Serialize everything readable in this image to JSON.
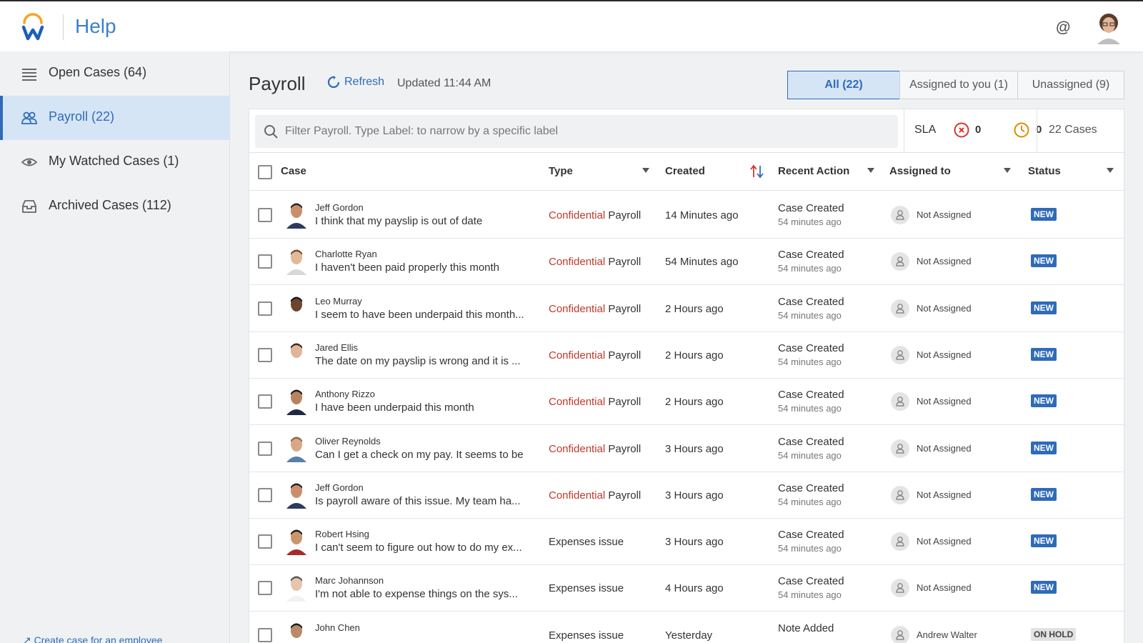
{
  "header": {
    "title": "Help"
  },
  "sidebar": {
    "items": [
      {
        "label": "Open Cases (64)",
        "icon": "list-icon"
      },
      {
        "label": "Payroll (22)",
        "icon": "group-icon"
      },
      {
        "label": "My Watched Cases (1)",
        "icon": "eye-icon"
      },
      {
        "label": "Archived Cases (112)",
        "icon": "archive-icon"
      }
    ],
    "active_index": 1,
    "create_link": "Create case for an employee"
  },
  "main": {
    "title": "Payroll",
    "refresh_label": "Refresh",
    "updated": "Updated 11:44 AM",
    "tabs": [
      {
        "label": "All (22)"
      },
      {
        "label": "Assigned to you (1)"
      },
      {
        "label": "Unassigned (9)"
      }
    ],
    "filter_placeholder": "Filter Payroll. Type Label: to narrow by a specific label",
    "sla": {
      "label": "SLA",
      "overdue": "0",
      "warning": "0"
    },
    "case_count": "22 Cases",
    "columns": {
      "case": "Case",
      "type": "Type",
      "created": "Created",
      "recent_action": "Recent Action",
      "assigned_to": "Assigned to",
      "status": "Status"
    },
    "rows": [
      {
        "name": "Jeff Gordon",
        "subject": "I think that my payslip is out of date",
        "type_prefix": "Confidential",
        "type": "Payroll",
        "created": "14 Minutes ago",
        "action": "Case Created",
        "action_time": "54 minutes ago",
        "assigned": "Not Assigned",
        "status": "NEW"
      },
      {
        "name": "Charlotte Ryan",
        "subject": "I haven't been paid properly this month",
        "type_prefix": "Confidential",
        "type": "Payroll",
        "created": "54 Minutes ago",
        "action": "Case Created",
        "action_time": "54 minutes ago",
        "assigned": "Not Assigned",
        "status": "NEW"
      },
      {
        "name": "Leo Murray",
        "subject": "I seem to have been underpaid this month...",
        "type_prefix": "Confidential",
        "type": "Payroll",
        "created": "2 Hours ago",
        "action": "Case Created",
        "action_time": "54 minutes ago",
        "assigned": "Not Assigned",
        "status": "NEW"
      },
      {
        "name": "Jared Ellis",
        "subject": "The date on my payslip is wrong and it is ...",
        "type_prefix": "Confidential",
        "type": "Payroll",
        "created": "2 Hours ago",
        "action": "Case Created",
        "action_time": "54 minutes ago",
        "assigned": "Not Assigned",
        "status": "NEW"
      },
      {
        "name": "Anthony Rizzo",
        "subject": "I have been underpaid this month",
        "type_prefix": "Confidential",
        "type": "Payroll",
        "created": "2 Hours ago",
        "action": "Case Created",
        "action_time": "54 minutes ago",
        "assigned": "Not Assigned",
        "status": "NEW"
      },
      {
        "name": "Oliver Reynolds",
        "subject": "Can I get a check on my pay. It seems to be",
        "type_prefix": "Confidential",
        "type": "Payroll",
        "created": "3 Hours ago",
        "action": "Case Created",
        "action_time": "54 minutes ago",
        "assigned": "Not Assigned",
        "status": "NEW"
      },
      {
        "name": "Jeff Gordon",
        "subject": "Is payroll aware of this issue. My team ha...",
        "type_prefix": "Confidential",
        "type": "Payroll",
        "created": "3 Hours ago",
        "action": "Case Created",
        "action_time": "54 minutes ago",
        "assigned": "Not Assigned",
        "status": "NEW"
      },
      {
        "name": "Robert Hsing",
        "subject": "I can't seem to figure out how to do my ex...",
        "type_prefix": "",
        "type": "Expenses issue",
        "created": "3 Hours ago",
        "action": "Case Created",
        "action_time": "54 minutes ago",
        "assigned": "Not Assigned",
        "status": "NEW"
      },
      {
        "name": "Marc Johannson",
        "subject": "I'm not able to expense things on the sys...",
        "type_prefix": "",
        "type": "Expenses issue",
        "created": "4 Hours ago",
        "action": "Case Created",
        "action_time": "54 minutes ago",
        "assigned": "Not Assigned",
        "status": "NEW"
      },
      {
        "name": "John Chen",
        "subject": "",
        "type_prefix": "",
        "type": "Expenses issue",
        "created": "Yesterday",
        "action": "Note Added",
        "action_time": "",
        "assigned": "Andrew Walter",
        "status": "ON HOLD"
      }
    ]
  },
  "colors": {
    "accent": "#2f6bb8",
    "confidential": "#c0392b",
    "active_bg": "#d6e5f6",
    "sla_overdue": "#d9342b",
    "sla_warning": "#e08a00"
  }
}
